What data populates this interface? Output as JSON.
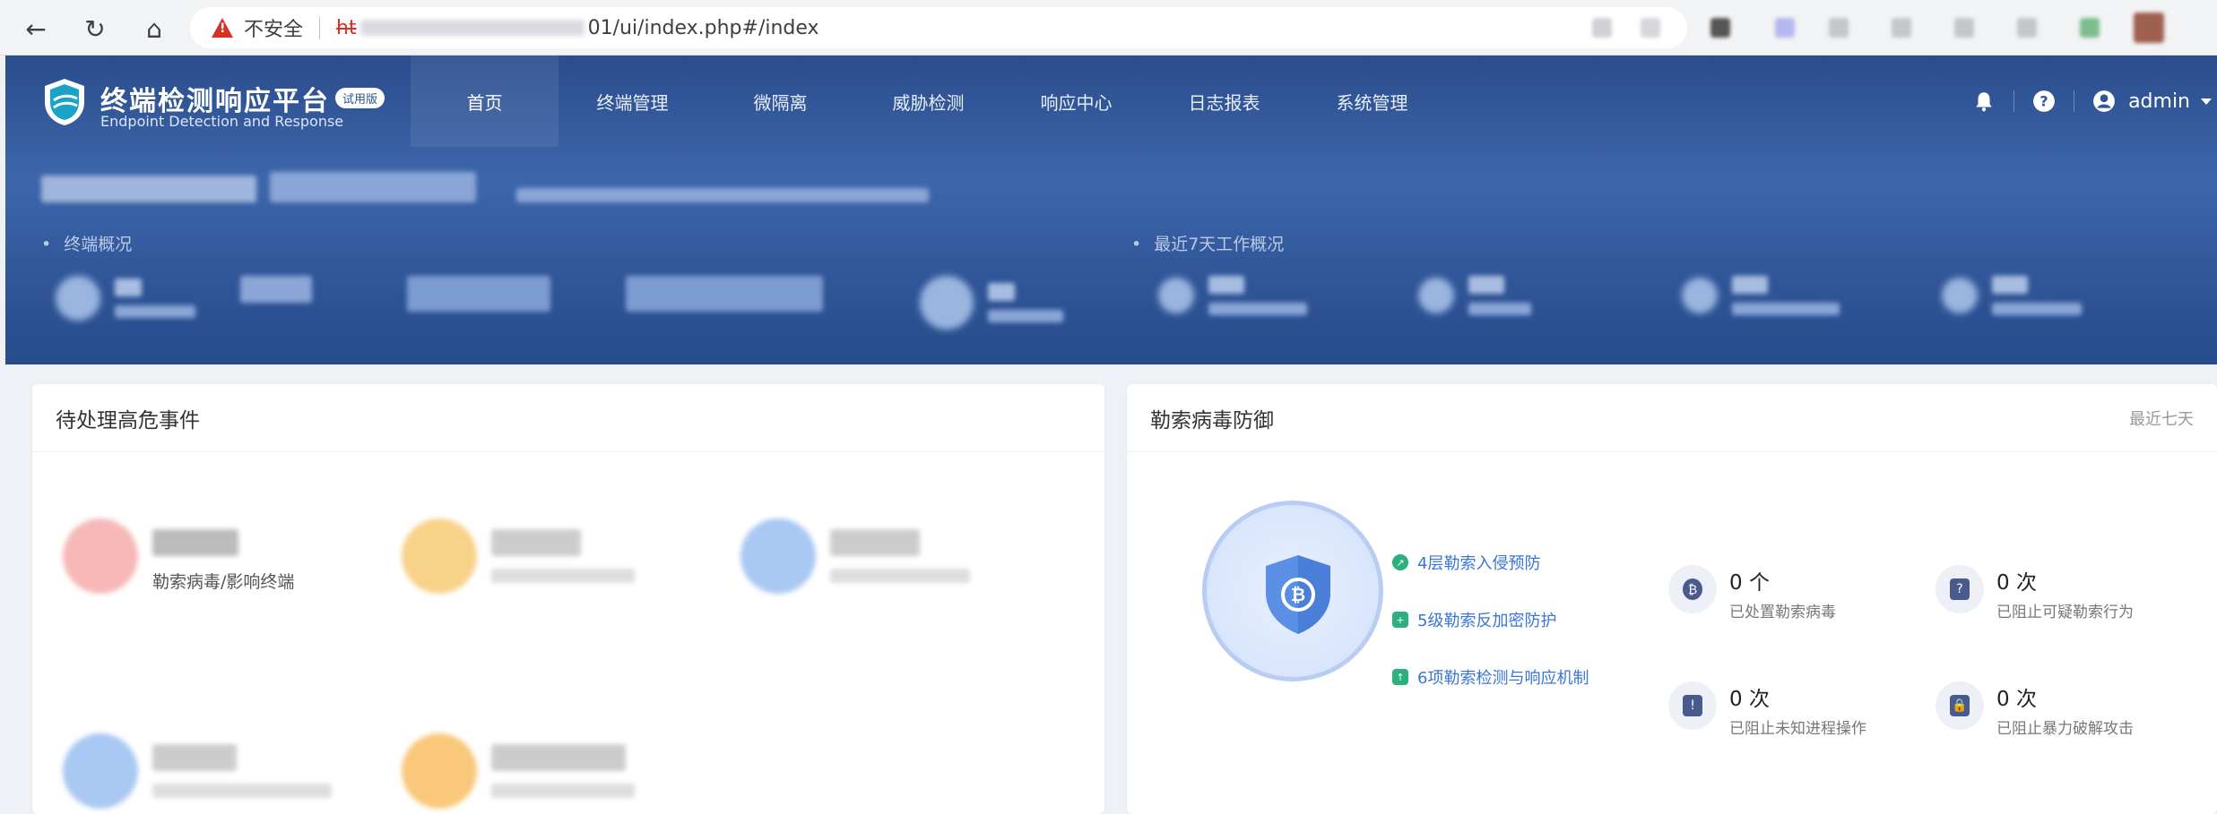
{
  "browser": {
    "security_label": "不安全",
    "url_scheme": "ht",
    "url_tail": "01/ui/index.php#/index"
  },
  "app": {
    "title": "终端检测响应平台",
    "subtitle": "Endpoint Detection and Response",
    "badge": "试用版",
    "menu": [
      "首页",
      "终端管理",
      "微隔离",
      "威胁检测",
      "响应中心",
      "日志报表",
      "系统管理"
    ],
    "active_menu": "首页",
    "user": "admin"
  },
  "overview": {
    "terminal_label": "终端概况",
    "week_label": "最近7天工作概况"
  },
  "events": {
    "title": "待处理高危事件",
    "first_label": "勒索病毒/影响终端"
  },
  "ransomware": {
    "title": "勒索病毒防御",
    "range": "最近七天",
    "features": [
      "4层勒索入侵预防",
      "5级勒索反加密防护",
      "6项勒索检测与响应机制"
    ],
    "stats": [
      {
        "value": "0 个",
        "label": "已处置勒索病毒",
        "icon": "bitcoin-icon"
      },
      {
        "value": "0 次",
        "label": "已阻止可疑勒索行为",
        "icon": "question-icon"
      },
      {
        "value": "0 次",
        "label": "已阻止未知进程操作",
        "icon": "alert-window-icon"
      },
      {
        "value": "0 次",
        "label": "已阻止暴力破解攻击",
        "icon": "lock-icon"
      }
    ]
  },
  "colors": {
    "hero": "#2f5597",
    "accent": "#3a74d6",
    "feature_green": "#2bb07f"
  }
}
